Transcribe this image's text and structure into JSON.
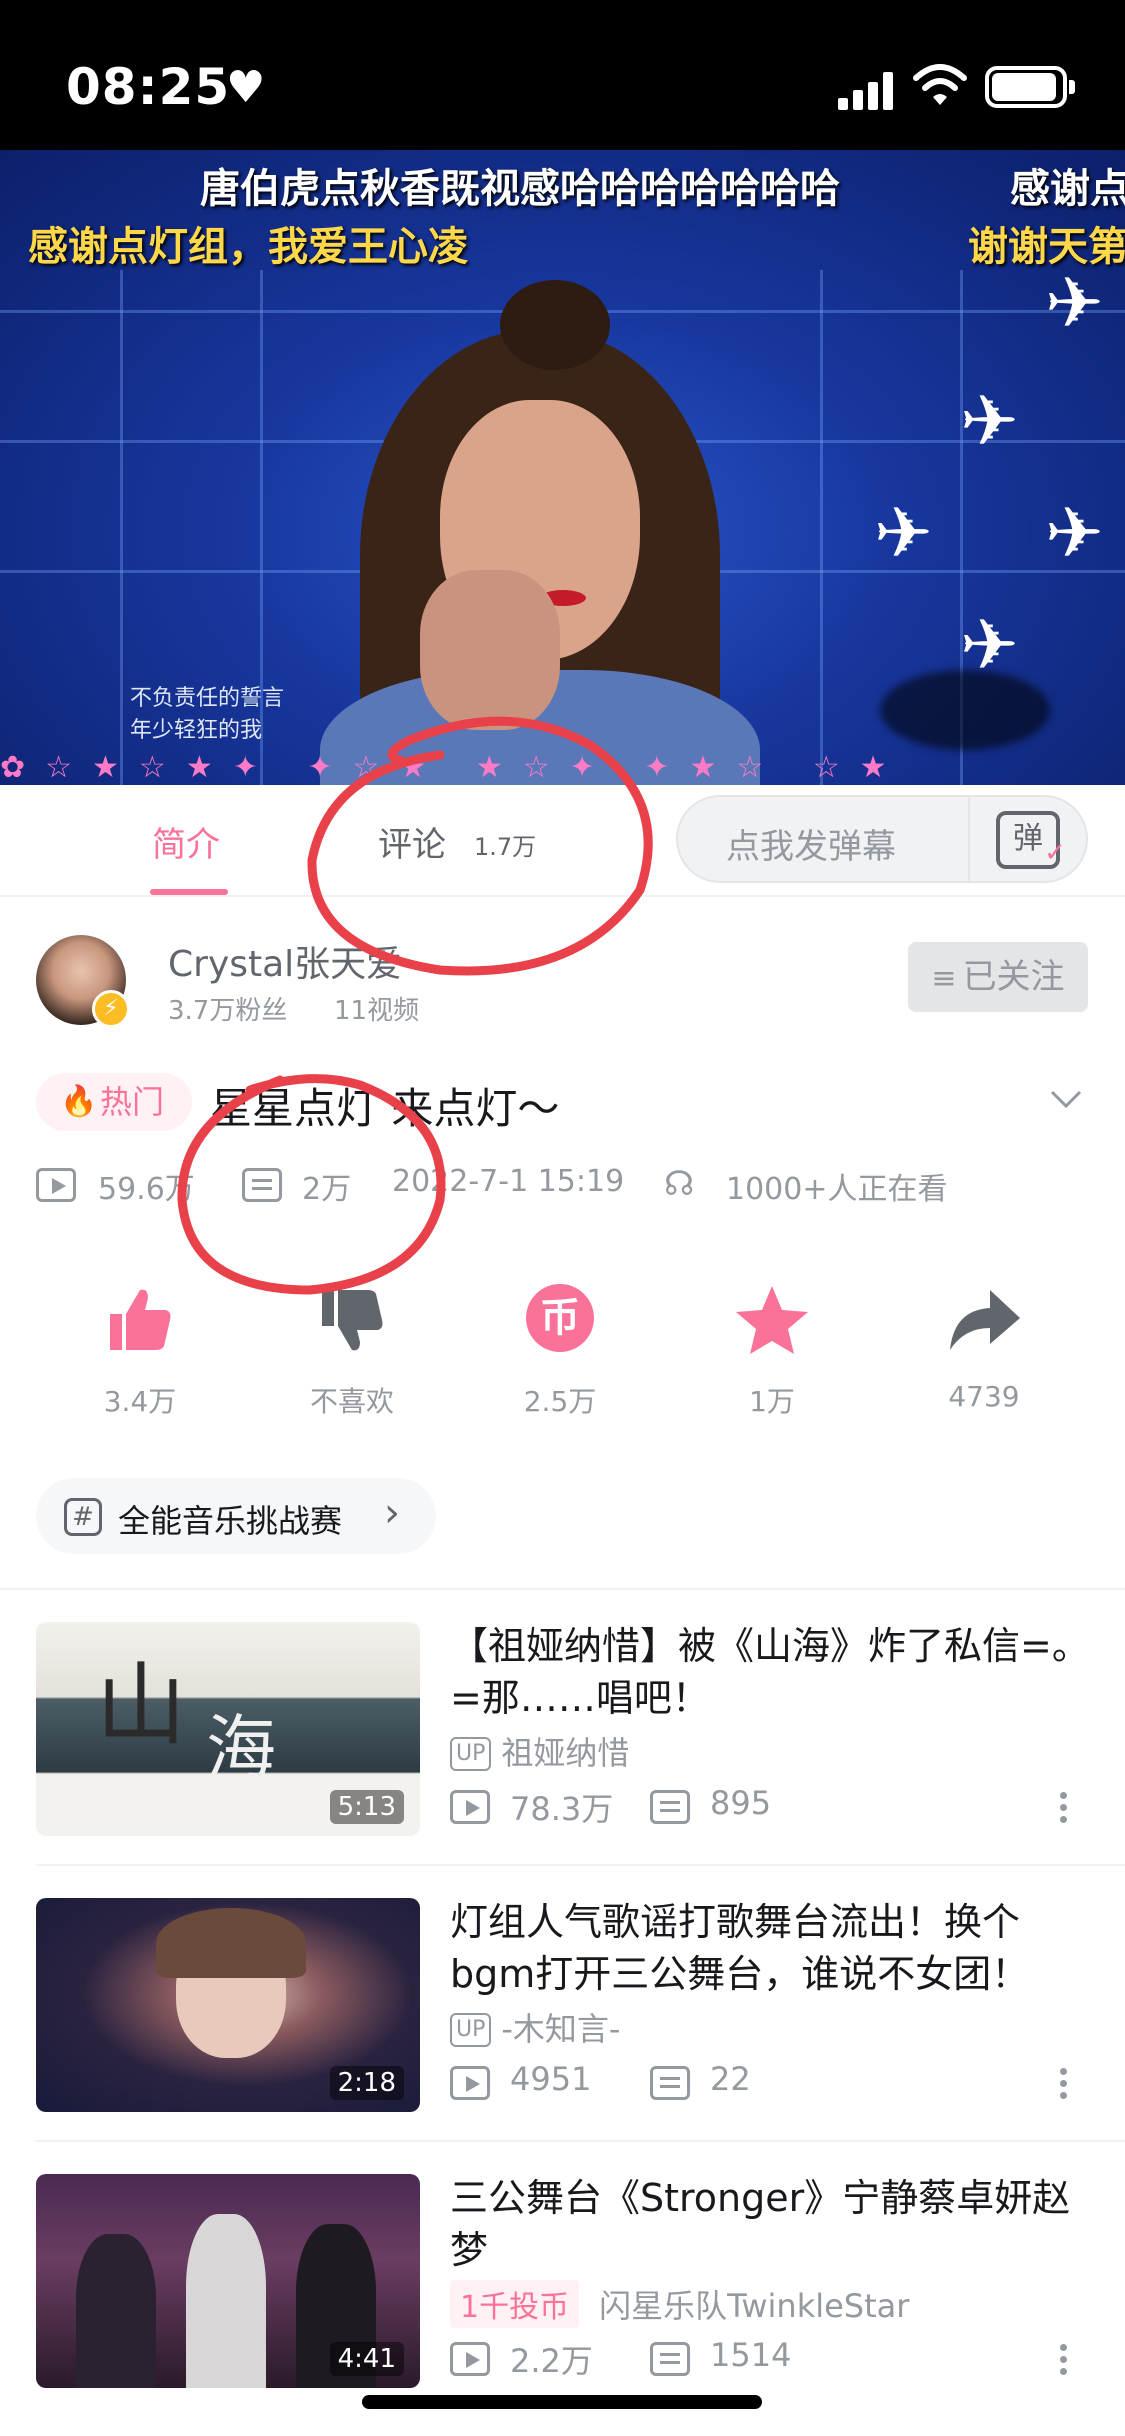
{
  "status_bar": {
    "time": "08:25"
  },
  "video": {
    "danmaku": [
      {
        "text": "唐伯虎点秋香既视感哈哈哈哈哈哈哈",
        "color": "white"
      },
      {
        "text": "感谢点",
        "color": "white"
      },
      {
        "text": "感谢点灯组，我爱王心凌",
        "color": "yellow"
      },
      {
        "text": "谢谢天第",
        "color": "yellow"
      }
    ],
    "lyrics": [
      "不负责任的誓言",
      "年少轻狂的我"
    ]
  },
  "tabs": {
    "intro": "简介",
    "comments": "评论",
    "comments_count": "1.7万",
    "danmu_placeholder": "点我发弹幕",
    "danmu_icon": "弹"
  },
  "uploader": {
    "name": "Crystal张天爱",
    "fans": "3.7万粉丝",
    "videos": "11视频",
    "follow_label": "已关注"
  },
  "video_info": {
    "hot_tag": "热门",
    "title": "星星点灯  来点灯～",
    "plays": "59.6万",
    "danmaku": "2万",
    "date": "2022-7-1 15:19",
    "watching": "1000+人正在看"
  },
  "actions": [
    {
      "label": "3.4万",
      "icon": "thumbs-up-icon"
    },
    {
      "label": "不喜欢",
      "icon": "thumbs-down-icon"
    },
    {
      "label": "2.5万",
      "icon": "coin-icon"
    },
    {
      "label": "1万",
      "icon": "star-icon"
    },
    {
      "label": "4739",
      "icon": "share-icon"
    }
  ],
  "topic": {
    "label": "全能音乐挑战赛"
  },
  "related": [
    {
      "title": "【祖娅纳惜】被《山海》炸了私信=。=那……唱吧！",
      "up_badge": "UP",
      "up": "祖娅纳惜",
      "coin_badge": "",
      "plays": "78.3万",
      "danmaku": "895",
      "duration": "5:13"
    },
    {
      "title": "灯组人气歌谣打歌舞台流出！换个bgm打开三公舞台，谁说不女团！",
      "up_badge": "UP",
      "up": "-木知言-",
      "coin_badge": "",
      "plays": "4951",
      "danmaku": "22",
      "duration": "2:18"
    },
    {
      "title": "三公舞台《Stronger》宁静蔡卓妍赵梦",
      "up_badge": "",
      "up": "闪星乐队TwinkleStar",
      "coin_badge": "1千投币",
      "plays": "2.2万",
      "danmaku": "1514",
      "duration": "4:41"
    }
  ],
  "colors": {
    "accent": "#fb7299",
    "annotation": "#e8414a",
    "text_secondary": "#9499a0"
  }
}
